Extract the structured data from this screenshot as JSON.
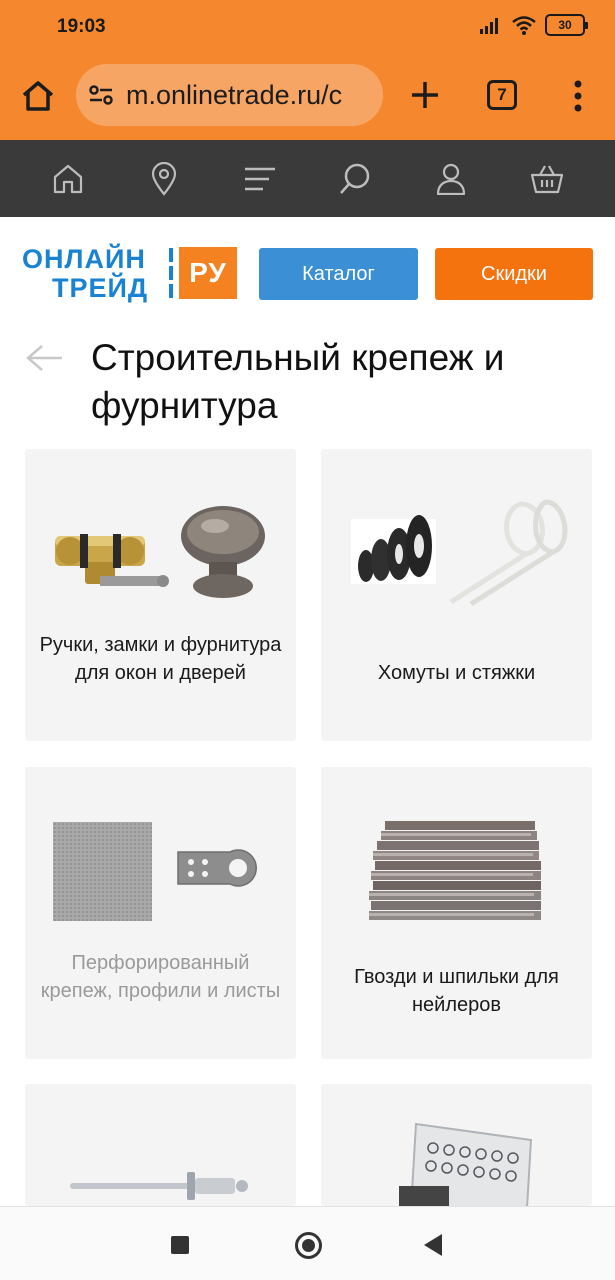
{
  "status": {
    "time": "19:03",
    "battery": "30"
  },
  "browser": {
    "url": "m.onlinetrade.ru/c",
    "tab_count": "7"
  },
  "logo": {
    "line1": "ОНЛАЙН",
    "line2": "ТРЕЙД",
    "ru": "РУ"
  },
  "header": {
    "catalog_label": "Каталог",
    "sale_label": "Скидки"
  },
  "page": {
    "title": "Строительный крепеж и фурнитура"
  },
  "categories": [
    {
      "label": "Ручки, замки и фурнитура для окон и дверей",
      "disabled": false
    },
    {
      "label": "Хомуты и стяжки",
      "disabled": false
    },
    {
      "label": "Перфорированный крепеж, профили и листы",
      "disabled": true
    },
    {
      "label": "Гвозди и шпильки для нейлеров",
      "disabled": false
    },
    {
      "label": "",
      "disabled": false
    },
    {
      "label": "",
      "disabled": false
    }
  ],
  "colors": {
    "accent": "#f5882e",
    "brand_blue": "#1a82d2",
    "catalog": "#3b8fd4",
    "sale": "#f5730e"
  }
}
